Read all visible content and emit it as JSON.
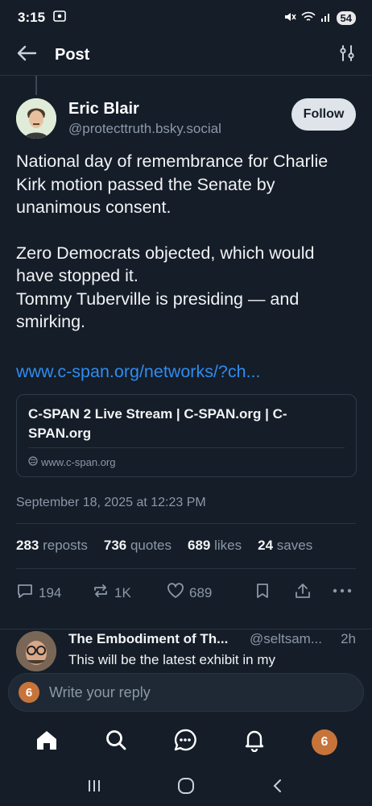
{
  "status_bar": {
    "time": "3:15",
    "battery": "54"
  },
  "header": {
    "title": "Post"
  },
  "post": {
    "author_name": "Eric Blair",
    "author_handle": "@protecttruth.bsky.social",
    "follow_label": "Follow",
    "paragraphs": [
      "National day of remembrance for Charlie Kirk motion passed the Senate by unanimous consent.",
      "Zero Democrats objected, which would have stopped it.",
      "Tommy Tuberville is presiding — and smirking."
    ],
    "link_text": "www.c-span.org/networks/?ch...",
    "embed": {
      "title": "C-SPAN 2 Live Stream | C-SPAN.org | C-SPAN.org",
      "domain": "www.c-span.org"
    },
    "date": "September 18, 2025 at 12:23 PM",
    "stats": {
      "reposts_count": "283",
      "reposts_label": "reposts",
      "quotes_count": "736",
      "quotes_label": "quotes",
      "likes_count": "689",
      "likes_label": "likes",
      "saves_count": "24",
      "saves_label": "saves"
    },
    "actions": {
      "replies": "194",
      "reposts": "1K",
      "likes": "689"
    }
  },
  "reply": {
    "author_name": "The Embodiment of Th...",
    "author_handle": "@seltsam...",
    "time": "2h",
    "text": "This will be the latest exhibit in my"
  },
  "composer": {
    "placeholder": "Write your reply",
    "avatar_glyph": "6"
  },
  "tab_bar": {
    "avatar_glyph": "6"
  },
  "colors": {
    "background": "#151d28",
    "link": "#2f8cf0",
    "muted": "#8b98a8"
  }
}
